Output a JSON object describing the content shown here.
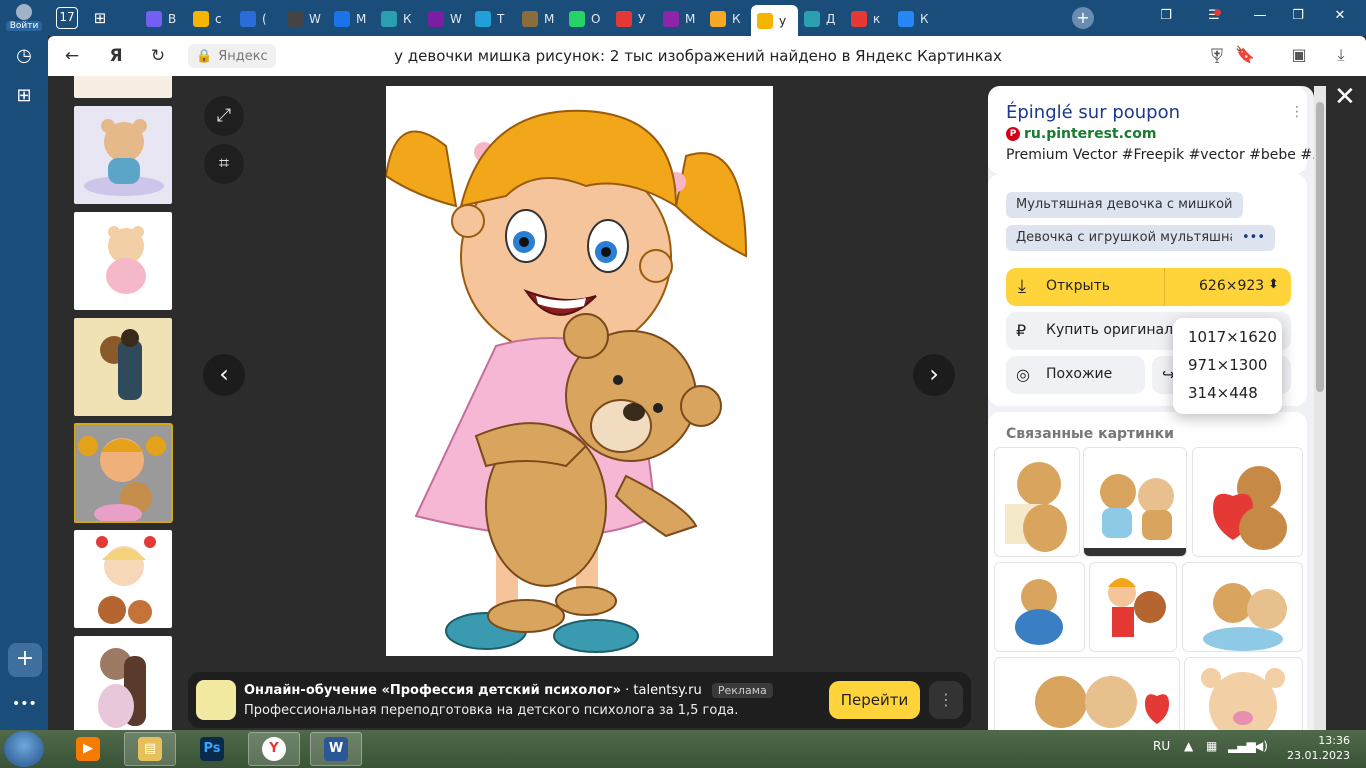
{
  "browser": {
    "login_label": "Войти",
    "tab_counter": "17",
    "tabs": [
      {
        "icon": "viber-icon",
        "letter": "В",
        "color": "#7360f2"
      },
      {
        "icon": "image-icon",
        "letter": "с",
        "color": "#f4b400"
      },
      {
        "icon": "mail-icon",
        "letter": "(",
        "color": "#2b6cd8"
      },
      {
        "icon": "wiki-icon",
        "letter": "W",
        "color": "#444444"
      },
      {
        "icon": "messenger-icon",
        "letter": "М",
        "color": "#1a73e8"
      },
      {
        "icon": "book-icon",
        "letter": "К",
        "color": "#2a9fb0"
      },
      {
        "icon": "w-purple-icon",
        "letter": "W",
        "color": "#7a1fa2"
      },
      {
        "icon": "telegram-icon",
        "letter": "Т",
        "color": "#229ed9"
      },
      {
        "icon": "photo-icon",
        "letter": "М",
        "color": "#8a6d3b"
      },
      {
        "icon": "whatsapp-icon",
        "letter": "О",
        "color": "#25d366"
      },
      {
        "icon": "shop-icon",
        "letter": "У",
        "color": "#e53935"
      },
      {
        "icon": "m-purple-icon",
        "letter": "М",
        "color": "#8e24aa"
      },
      {
        "icon": "play-icon",
        "letter": "К",
        "color": "#f9a825"
      },
      {
        "icon": "image-icon",
        "letter": "у",
        "color": "#f4b400"
      },
      {
        "icon": "book-icon",
        "letter": "Д",
        "color": "#2a9fb0"
      },
      {
        "icon": "yandex-icon",
        "letter": "к",
        "color": "#e53935"
      },
      {
        "icon": "vk-icon",
        "letter": "К",
        "color": "#2787f5"
      }
    ],
    "domain": "Яндекс",
    "page_title": "у девочки мишка рисунок: 2 тыс изображений найдено в Яндекс Картинках",
    "notification_count": "1"
  },
  "ad": {
    "title": "Онлайн-обучение «Профессия детский психолог»",
    "domain": "talentsy.ru",
    "tag": "Реклама",
    "description": "Профессиональная переподготовка на детского психолога за 1,5 года.",
    "button": "Перейти"
  },
  "panel": {
    "title": "Épinglé sur poupon",
    "source": "ru.pinterest.com",
    "description": "Premium Vector #Freepik #vector #bebe #...",
    "chips": [
      "Мультяшная девочка с мишкой",
      "Девочка с игрушкой мультяшная",
      "•••"
    ],
    "open_label": "Открыть",
    "size_selected": "626×923",
    "buy_label": "Купить оригинал ка",
    "similar_label": "Похожие",
    "related_heading": "Связанные картинки"
  },
  "size_dropdown": {
    "options": [
      "1017×1620",
      "971×1300",
      "314×448"
    ]
  },
  "taskbar": {
    "language": "RU",
    "time": "13:36",
    "date": "23.01.2023"
  }
}
